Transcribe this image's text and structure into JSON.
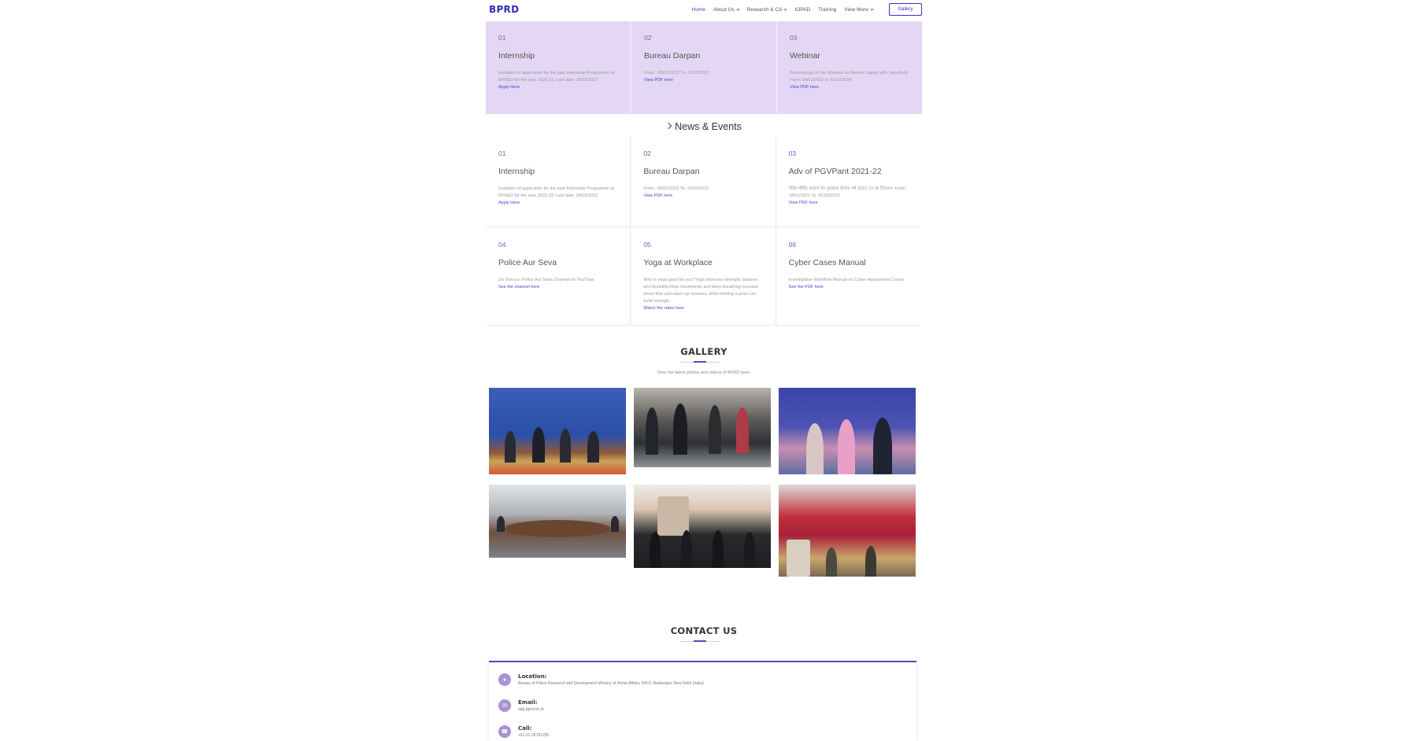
{
  "header": {
    "logo": "BPRD",
    "nav": [
      "Home",
      "About Us",
      "Research & CA",
      "IOPAD",
      "Training",
      "View More"
    ],
    "button": "Gallery"
  },
  "top_cards": [
    {
      "num": "01",
      "title": "Internship",
      "desc": "Invitation of application for the paid Internship Programme at BPR&D for the year 2022-23. Last date: 28/02/2022",
      "link": "Apply Here"
    },
    {
      "num": "02",
      "title": "Bureau Darpan",
      "desc": "From : 05/01/2022 To: 31/03/2022",
      "link": "View PDF here"
    },
    {
      "num": "03",
      "title": "Webinar",
      "desc": "Proceedings of the Webinar on Women Safety with Sensitivity From: 04/01/2022 to 31/12/2024",
      "link": "View PDF here"
    }
  ],
  "news": {
    "title": "News & Events",
    "items": [
      {
        "num": "01",
        "title": "Internship",
        "desc": "Invitation of application for the paid Internship Programme at BPR&D for the year 2022-23. Last date: 28/02/2022",
        "link": "Apply Here"
      },
      {
        "num": "02",
        "title": "Bureau Darpan",
        "desc": "From : 05/01/2022 To: 31/03/2022",
        "link": "View PDF here"
      },
      {
        "num": "03",
        "title": "Adv of PGVPant 2021-22",
        "desc": "पंडित गोविंद वल्लभ पंत पुरस्कार योजना वर्ष 2021-22 का विज्ञापन. From : 18/11/2021 To: 31/03/2022",
        "link": "View PDF here"
      },
      {
        "num": "04",
        "title": "Police Aur Seva",
        "desc": "Do Visit our Police Aur Seva Channel on YouTube",
        "link": "See the channel here"
      },
      {
        "num": "05",
        "title": "Yoga at Workplace",
        "desc": "Why is yoga good for you?Yoga improves strength, balance and flexibility.Slow movements and deep breathing increase blood flow and warm up muscles, while holding a pose can build strength.",
        "link": "Watch the video here"
      },
      {
        "num": "06",
        "title": "Cyber Cases Manual",
        "desc": "Investigative Workflow Manual on Cyber Harassment Cases",
        "link": "See the PDF here"
      }
    ]
  },
  "gallery": {
    "title": "GALLERY",
    "subtitle": "View the latest photos and videos of BPRD here."
  },
  "contact": {
    "title": "CONTACT US",
    "location_label": "Location:",
    "location_value": "Bureau of Police Research and Development Ministry of Home Affairs, NH-8, Mahipalpur New Delhi (India)",
    "email_label": "Email:",
    "email_value": "adg.bprd.nic.in",
    "call_label": "Call:",
    "call_value": "+91-11-26781255"
  },
  "colors": {
    "brand": "#2f2fb8",
    "lavender": "#e4d7f5",
    "accent": "#5a46c8",
    "link": "#4b3fd1"
  }
}
